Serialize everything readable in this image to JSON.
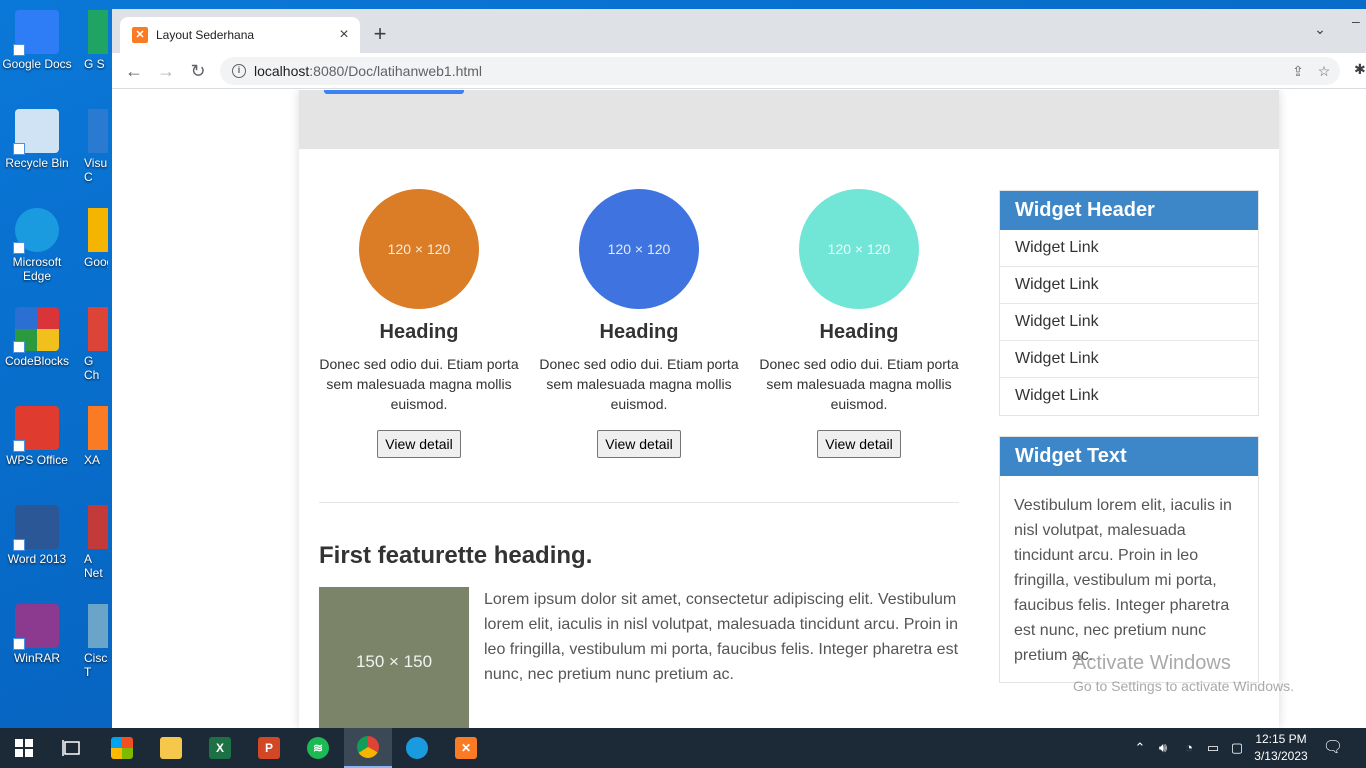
{
  "desktop": {
    "icons": [
      {
        "label": "Google Docs",
        "color": "#2f7df6"
      },
      {
        "label": "Recycle Bin",
        "color": "#cfe3f5"
      },
      {
        "label": "Microsoft Edge",
        "color": "#1a9be0"
      },
      {
        "label": "CodeBlocks",
        "color": "#d9343a"
      },
      {
        "label": "WPS Office",
        "color": "#e03b2f"
      },
      {
        "label": "Word 2013",
        "color": "#2b5797"
      },
      {
        "label": "WinRAR",
        "color": "#8b3a8f"
      }
    ],
    "partial_icons": [
      {
        "label": "G S",
        "color": "#1fa463"
      },
      {
        "label": "Visu C",
        "color": "#2a7ad1"
      },
      {
        "label": "Goog",
        "color": "#f4b400"
      },
      {
        "label": "G Ch",
        "color": "#db4437"
      },
      {
        "label": "XA",
        "color": "#fb7a24"
      },
      {
        "label": "A Net",
        "color": "#c23a3a"
      },
      {
        "label": "Cisc T",
        "color": "#6aa5c9"
      }
    ]
  },
  "browser": {
    "tab_title": "Layout Sederhana",
    "url_host": "localhost",
    "url_path": ":8080/Doc/latihanweb1.html"
  },
  "page": {
    "columns": [
      {
        "placeholder": "120 × 120",
        "color": "#db7c26",
        "heading": "Heading",
        "text": "Donec sed odio dui. Etiam porta sem malesuada magna mollis euismod.",
        "button": "View detail"
      },
      {
        "placeholder": "120 × 120",
        "color": "#3e73e0",
        "heading": "Heading",
        "text": "Donec sed odio dui. Etiam porta sem malesuada magna mollis euismod.",
        "button": "View detail"
      },
      {
        "placeholder": "120 × 120",
        "color": "#72e6d6",
        "heading": "Heading",
        "text": "Donec sed odio dui. Etiam porta sem malesuada magna mollis euismod.",
        "button": "View detail"
      }
    ],
    "featurette": {
      "heading": "First featurette heading.",
      "image_placeholder": "150 × 150",
      "text": "Lorem ipsum dolor sit amet, consectetur adipiscing elit. Vestibulum lorem elit, iaculis in nisl volutpat, malesuada tincidunt arcu. Proin in leo fringilla, vestibulum mi porta, faucibus felis. Integer pharetra est nunc, nec pretium nunc pretium ac."
    },
    "widget_links": {
      "header": "Widget Header",
      "links": [
        "Widget Link",
        "Widget Link",
        "Widget Link",
        "Widget Link",
        "Widget Link"
      ]
    },
    "widget_text": {
      "header": "Widget Text",
      "body": "Vestibulum lorem elit, iaculis in nisl volutpat, malesuada tincidunt arcu. Proin in leo fringilla, vestibulum mi porta, faucibus felis. Integer pharetra est nunc, nec pretium nunc pretium ac."
    }
  },
  "watermark": {
    "line1": "Activate Windows",
    "line2": "Go to Settings to activate Windows."
  },
  "taskbar": {
    "time": "12:15 PM",
    "date": "3/13/2023"
  }
}
